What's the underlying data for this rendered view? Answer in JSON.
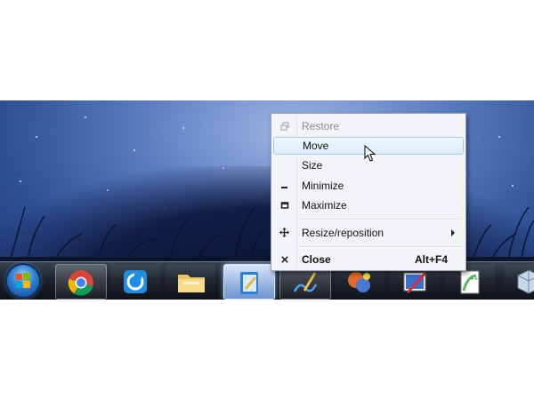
{
  "context_menu": {
    "items": [
      {
        "label": "Restore",
        "shortcut": "",
        "state": "disabled",
        "icon": "restore-icon"
      },
      {
        "label": "Move",
        "shortcut": "",
        "state": "hover",
        "icon": ""
      },
      {
        "label": "Size",
        "shortcut": "",
        "state": "normal",
        "icon": ""
      },
      {
        "label": "Minimize",
        "shortcut": "",
        "state": "normal",
        "icon": "minimize-icon"
      },
      {
        "label": "Maximize",
        "shortcut": "",
        "state": "normal",
        "icon": "maximize-icon"
      },
      {
        "label": "Resize/reposition",
        "shortcut": "",
        "state": "submenu",
        "icon": "move-arrows-icon"
      },
      {
        "label": "Close",
        "shortcut": "Alt+F4",
        "state": "bold",
        "icon": "close-x-icon"
      }
    ]
  },
  "taskbar": {
    "apps": [
      {
        "name": "chrome",
        "icon": "chrome-icon",
        "state": "framed"
      },
      {
        "name": "rocketdock",
        "icon": "rocketdock-icon",
        "state": "inactive"
      },
      {
        "name": "explorer",
        "icon": "folder-icon",
        "state": "inactive"
      },
      {
        "name": "notes",
        "icon": "notebook-icon",
        "state": "active"
      },
      {
        "name": "inkscape",
        "icon": "pen-signature-icon",
        "state": "framed"
      },
      {
        "name": "paint",
        "icon": "paint-icon",
        "state": "inactive"
      },
      {
        "name": "image-editor",
        "icon": "picture-edit-icon",
        "state": "inactive"
      },
      {
        "name": "notepad-plus",
        "icon": "notepad-plus-icon",
        "state": "inactive"
      },
      {
        "name": "virtualbox",
        "icon": "virtualbox-icon",
        "state": "inactive"
      }
    ]
  },
  "colors": {
    "menu_bg": "#f2f4f7",
    "hover_border": "#a8cbe9",
    "disabled_text": "#8c8c8c",
    "taskbar_bg": "#1d232e"
  }
}
